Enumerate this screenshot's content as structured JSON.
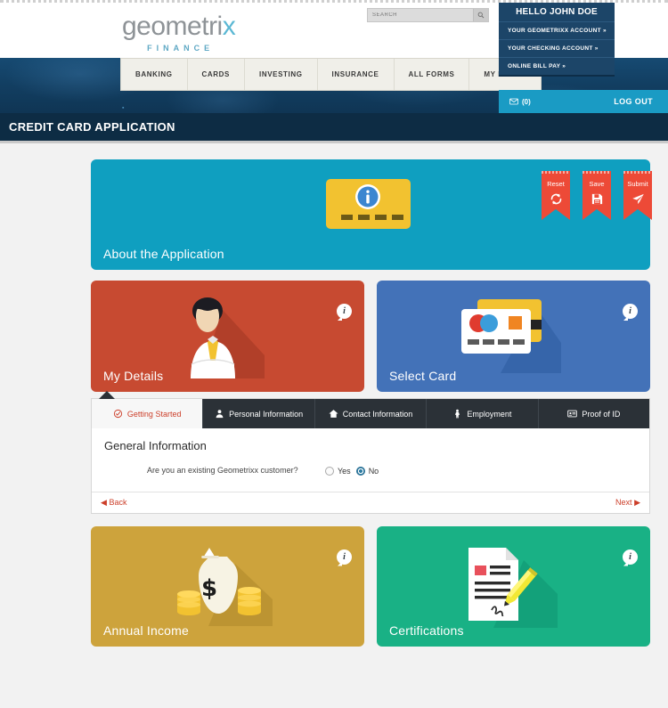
{
  "brand": {
    "name_part1": "geometri",
    "name_x": "x",
    "tagline": "FINANCE"
  },
  "search": {
    "placeholder": "SEARCH",
    "icon": "search-icon"
  },
  "account_menu": {
    "greeting": "HELLO JOHN DOE",
    "items": [
      {
        "label": "YOUR GEOMETRIXX ACCOUNT »"
      },
      {
        "label": "YOUR CHECKING ACCOUNT »"
      },
      {
        "label": "ONLINE BILL PAY »"
      }
    ]
  },
  "nav": {
    "items": [
      {
        "label": "BANKING"
      },
      {
        "label": "CARDS"
      },
      {
        "label": "INVESTING"
      },
      {
        "label": "INSURANCE"
      },
      {
        "label": "ALL FORMS"
      },
      {
        "label": "MY FORMS"
      }
    ]
  },
  "userbar": {
    "mail_icon": "envelope-icon",
    "mail_count": "(0)",
    "logout_label": "LOG OUT"
  },
  "page": {
    "title": "CREDIT CARD APPLICATION"
  },
  "ribbons": [
    {
      "label": "Reset",
      "icon": "refresh-icon"
    },
    {
      "label": "Save",
      "icon": "floppy-disk-icon"
    },
    {
      "label": "Submit",
      "icon": "paper-plane-icon"
    }
  ],
  "panels": {
    "about": {
      "title": "About the Application",
      "color": "#0f9fc0",
      "badge": "i",
      "art": "info-card-illustration"
    },
    "details": {
      "title": "My Details",
      "color": "#c74a31",
      "badge": "i",
      "art": "businessman-illustration"
    },
    "card": {
      "title": "Select Card",
      "color": "#4372b8",
      "badge": "i",
      "art": "credit-cards-illustration"
    },
    "income": {
      "title": "Annual Income",
      "color": "#cda33c",
      "badge": "i",
      "art": "money-bag-illustration"
    },
    "cert": {
      "title": "Certifications",
      "color": "#19b185",
      "badge": "i",
      "art": "signed-document-illustration"
    }
  },
  "tabs": [
    {
      "label": "Getting Started",
      "icon": "target-check-icon",
      "active": true
    },
    {
      "label": "Personal Information",
      "icon": "person-icon",
      "active": false
    },
    {
      "label": "Contact Information",
      "icon": "home-icon",
      "active": false
    },
    {
      "label": "Employment",
      "icon": "worker-icon",
      "active": false
    },
    {
      "label": "Proof of ID",
      "icon": "id-card-icon",
      "active": false
    }
  ],
  "form": {
    "heading": "General Information",
    "question_label": "Are you an existing Geometrixx customer?",
    "options": [
      {
        "label": "Yes",
        "selected": false
      },
      {
        "label": "No",
        "selected": true
      }
    ],
    "back_label": "Back",
    "next_label": "Next",
    "back_arrow": "◀",
    "next_arrow": "▶"
  }
}
